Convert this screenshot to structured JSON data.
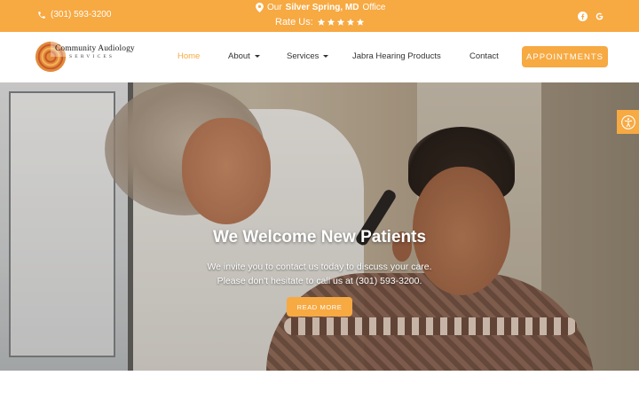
{
  "topbar": {
    "phone": "(301) 593-3200",
    "office_prefix": "Our",
    "office_location": "Silver Spring, MD",
    "office_suffix": "Office",
    "rate_label": "Rate Us:",
    "stars": 5,
    "social": [
      "facebook-icon",
      "google-icon"
    ]
  },
  "logo": {
    "title": "Community Audiology",
    "subtitle": "SERVICES"
  },
  "nav": {
    "items": [
      {
        "label": "Home",
        "active": true
      },
      {
        "label": "About",
        "dropdown": true
      },
      {
        "label": "Services",
        "dropdown": true
      },
      {
        "label": "Jabra Hearing Products"
      },
      {
        "label": "Contact"
      }
    ],
    "cta": "APPOINTMENTS"
  },
  "hero": {
    "title": "We Welcome New Patients",
    "line1": "We invite you to contact us today to discuss your care.",
    "line2": "Please don't hesitate to call us at (301) 593-3200.",
    "button": "READ MORE"
  },
  "colors": {
    "accent": "#f7a942",
    "text": "#333333"
  }
}
